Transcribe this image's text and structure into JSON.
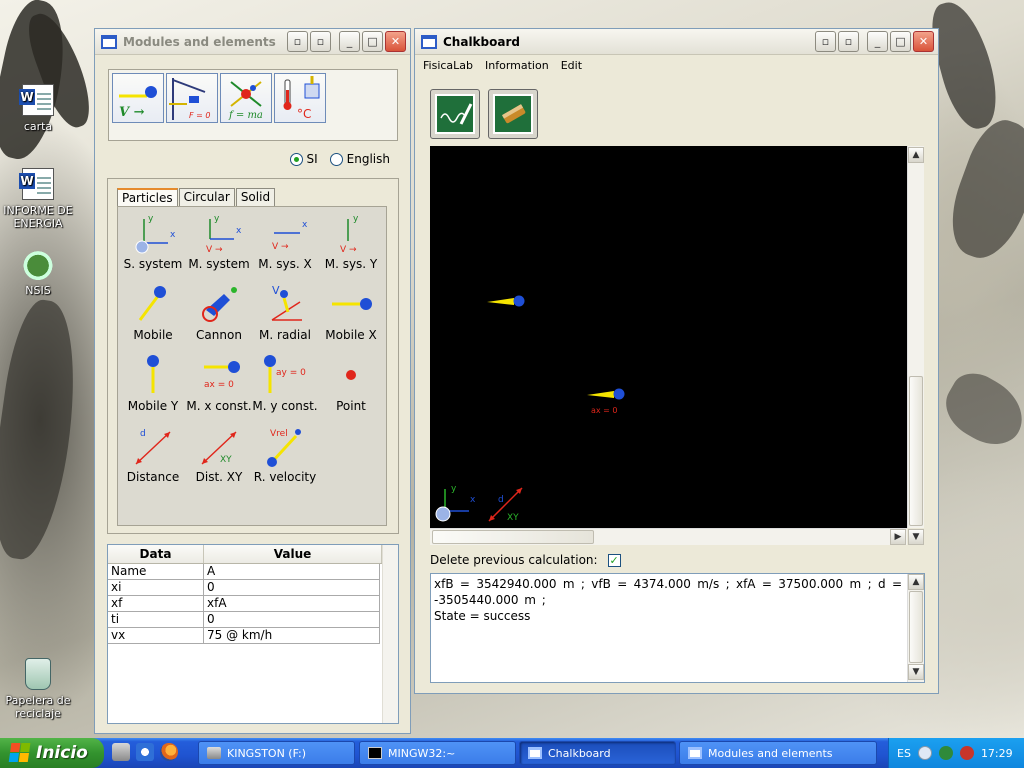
{
  "desktop": {
    "icons": [
      {
        "label": "carta"
      },
      {
        "label": "INFORME DE ENERGIA"
      },
      {
        "label": "NSIS"
      },
      {
        "label": "Papelera de reciclaje"
      }
    ]
  },
  "modules_window": {
    "title": "Modules and elements",
    "units": {
      "si": "SI",
      "english": "English",
      "selected": "SI"
    },
    "tabs": [
      "Particles",
      "Circular",
      "Solid"
    ],
    "active_tab": "Particles",
    "elements": [
      "S. system",
      "M. system",
      "M. sys. X",
      "M. sys. Y",
      "Mobile",
      "Cannon",
      "M. radial",
      "Mobile X",
      "Mobile Y",
      "M. x const.",
      "M. y const.",
      "Point",
      "Distance",
      "Dist. XY",
      "R. velocity"
    ],
    "icon_text": {
      "x": "x",
      "y": "y",
      "v_arrow": "V →",
      "v": "V",
      "d": "d",
      "xy": "XY",
      "vrel": "Vrel",
      "ax0": "ax = 0",
      "ay0": "ay = 0",
      "f0": "F = 0",
      "fma": "f = ma",
      "celsius": "°C"
    },
    "table": {
      "headers": [
        "Data",
        "Value"
      ],
      "rows": [
        [
          "Name",
          "A"
        ],
        [
          "xi",
          "0"
        ],
        [
          "xf",
          "xfA"
        ],
        [
          "ti",
          "0"
        ],
        [
          "vx",
          "75 @ km/h"
        ]
      ]
    }
  },
  "chalkboard_window": {
    "title": "Chalkboard",
    "menu": [
      "FisicaLab",
      "Information",
      "Edit"
    ],
    "board": {
      "label_ax": "ax = 0",
      "axis_x": "x",
      "axis_y": "y",
      "dist_d": "d",
      "dist_xy": "XY"
    },
    "delete_previous_label": "Delete previous calculation:",
    "delete_previous_checked": true,
    "output_line1": "xfB = 3542940.000 m ; vfB = 4374.000 m/s ; xfA = 37500.000 m ; d = -3505440.000 m ;",
    "output_line2": "State = success"
  },
  "taskbar": {
    "start_label": "Inicio",
    "tasks": [
      {
        "label": "KINGSTON (F:)",
        "active": false
      },
      {
        "label": "MINGW32:~",
        "active": false
      },
      {
        "label": "Chalkboard",
        "active": true
      },
      {
        "label": "Modules and elements",
        "active": false
      }
    ],
    "language": "ES",
    "clock": "17:29"
  },
  "colors": {
    "board_bg": "#000000",
    "accent_blue": "#1f4fd6",
    "accent_yellow": "#f5e400",
    "accent_red": "#e0261b",
    "xp_blue": "#245edb",
    "start_green": "#33932e"
  }
}
